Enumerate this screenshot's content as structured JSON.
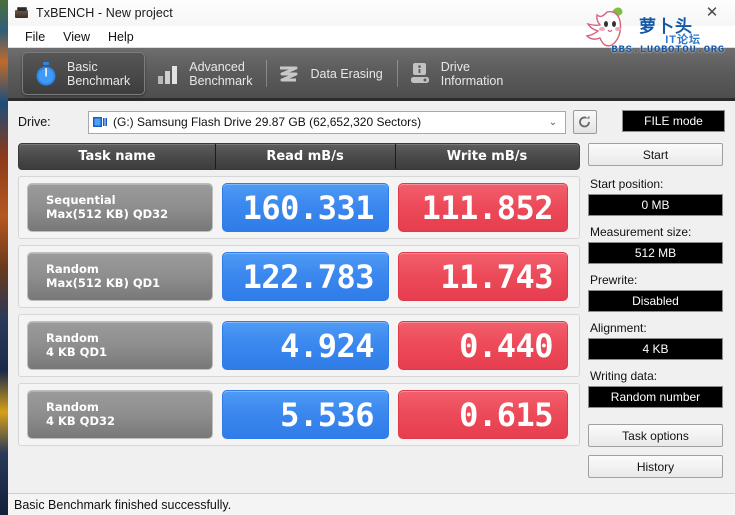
{
  "window": {
    "title": "TxBENCH - New project",
    "close_label": "✕",
    "app_icon": "camera-icon"
  },
  "menu": {
    "items": [
      {
        "label": "File"
      },
      {
        "label": "View"
      },
      {
        "label": "Help"
      }
    ]
  },
  "watermark": {
    "cn_title": "萝卜头",
    "cn_sub": "IT论坛",
    "url": "BBS.LUOBOTOU.ORG"
  },
  "tabs": [
    {
      "label": "Basic\nBenchmark",
      "icon": "stopwatch-icon",
      "active": true
    },
    {
      "label": "Advanced\nBenchmark",
      "icon": "bar-chart-icon",
      "active": false
    },
    {
      "label": "Data Erasing",
      "icon": "eraser-wave-icon",
      "active": false
    },
    {
      "label": "Drive\nInformation",
      "icon": "drive-info-icon",
      "active": false
    }
  ],
  "drive": {
    "label": "Drive:",
    "selected": "(G:) Samsung Flash Drive  29.87 GB (62,652,320 Sectors)",
    "caret": "⌄",
    "refresh_icon": "refresh-icon",
    "file_mode_label": "FILE mode"
  },
  "table": {
    "headers": {
      "task": "Task name",
      "read": "Read mB/s",
      "write": "Write mB/s"
    },
    "rows": [
      {
        "name_line1": "Sequential",
        "name_line2": "Max(512 KB) QD32",
        "read": "160.331",
        "write": "111.852"
      },
      {
        "name_line1": "Random",
        "name_line2": "Max(512 KB) QD1",
        "read": "122.783",
        "write": "11.743"
      },
      {
        "name_line1": "Random",
        "name_line2": "4 KB QD1",
        "read": "4.924",
        "write": "0.440"
      },
      {
        "name_line1": "Random",
        "name_line2": "4 KB QD32",
        "read": "5.536",
        "write": "0.615"
      }
    ]
  },
  "sidebar": {
    "start_label": "Start",
    "fields": [
      {
        "label": "Start position:",
        "value": "0 MB"
      },
      {
        "label": "Measurement size:",
        "value": "512 MB"
      },
      {
        "label": "Prewrite:",
        "value": "Disabled"
      },
      {
        "label": "Alignment:",
        "value": "4 KB"
      },
      {
        "label": "Writing data:",
        "value": "Random number"
      }
    ],
    "task_options_label": "Task options",
    "history_label": "History"
  },
  "status": {
    "text": "Basic Benchmark finished successfully."
  },
  "colors": {
    "read_blue": "#3b88ef",
    "write_red": "#ed4b5a",
    "tab_gray": "#5c5c5c",
    "value_black": "#000000"
  }
}
